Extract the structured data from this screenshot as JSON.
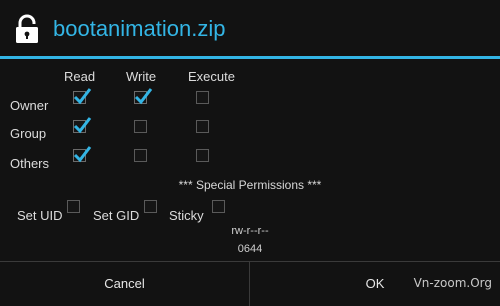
{
  "dialog": {
    "title": "bootanimation.zip",
    "accent_color": "#33b5e5",
    "icon": "lock-icon"
  },
  "permissions": {
    "columns": [
      "Read",
      "Write",
      "Execute"
    ],
    "rows": [
      {
        "label": "Owner",
        "read": true,
        "write": true,
        "execute": false
      },
      {
        "label": "Group",
        "read": true,
        "write": false,
        "execute": false
      },
      {
        "label": "Others",
        "read": true,
        "write": false,
        "execute": false
      }
    ]
  },
  "special": {
    "title": "*** Special Permissions ***",
    "set_uid_label": "Set UID",
    "set_uid": false,
    "set_gid_label": "Set GID",
    "set_gid": false,
    "sticky_label": "Sticky",
    "sticky": false
  },
  "summary": {
    "perm_string": "rw-r--r--",
    "octal": "0644"
  },
  "buttons": {
    "cancel_label": "Cancel",
    "ok_label": "OK"
  },
  "watermark": "Vn-zoom.Org"
}
